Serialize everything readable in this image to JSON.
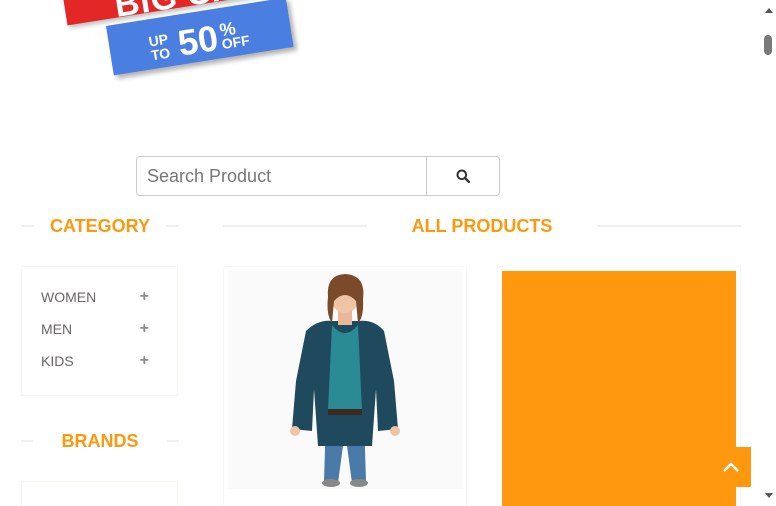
{
  "banner": {
    "headline": "BIG SALE",
    "up_to": "UP TO",
    "percent": "50",
    "percent_sign": "%",
    "off": "OFF",
    "colors": {
      "red": "#e32626",
      "blue": "#4a7ee0"
    }
  },
  "search": {
    "placeholder": "Search Product",
    "button_icon": "search-icon"
  },
  "category": {
    "title": "CATEGORY",
    "items": [
      {
        "label": "WOMEN",
        "icon": "plus-icon"
      },
      {
        "label": "MEN",
        "icon": "plus-icon"
      },
      {
        "label": "KIDS",
        "icon": "plus-icon"
      }
    ]
  },
  "brands": {
    "title": "BRANDS"
  },
  "products": {
    "title": "ALL PRODUCTS",
    "items": [
      {
        "image": "woman-in-cardigan-photo"
      },
      {
        "image": "orange-placeholder",
        "color": "#fe980f"
      }
    ]
  },
  "accent_color": "#fe980f",
  "scroll_top_icon": "chevron-up-icon"
}
